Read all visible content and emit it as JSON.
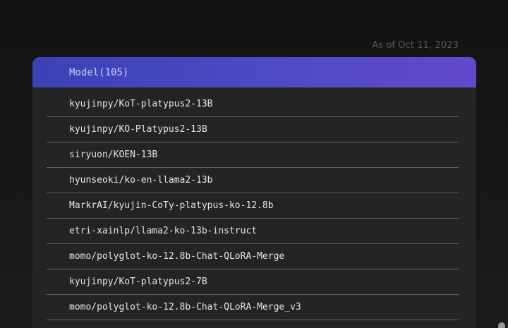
{
  "as_of": "As of Oct 11, 2023",
  "panel": {
    "header": "Model(105)",
    "rows": [
      "kyujinpy/KoT-platypus2-13B",
      "kyujinpy/KO-Platypus2-13B",
      "siryuon/KOEN-13B",
      "hyunseoki/ko-en-llama2-13b",
      "MarkrAI/kyujin-CoTy-platypus-ko-12.8b",
      "etri-xainlp/llama2-ko-13b-instruct",
      "momo/polyglot-ko-12.8b-Chat-QLoRA-Merge",
      "kyujinpy/KoT-platypus2-7B",
      "momo/polyglot-ko-12.8b-Chat-QLoRA-Merge_v3"
    ]
  },
  "colors": {
    "header_gradient_start": "#3a42b5",
    "header_gradient_end": "#6448cc",
    "panel_bg": "#242424",
    "page_bg": "#161616"
  }
}
